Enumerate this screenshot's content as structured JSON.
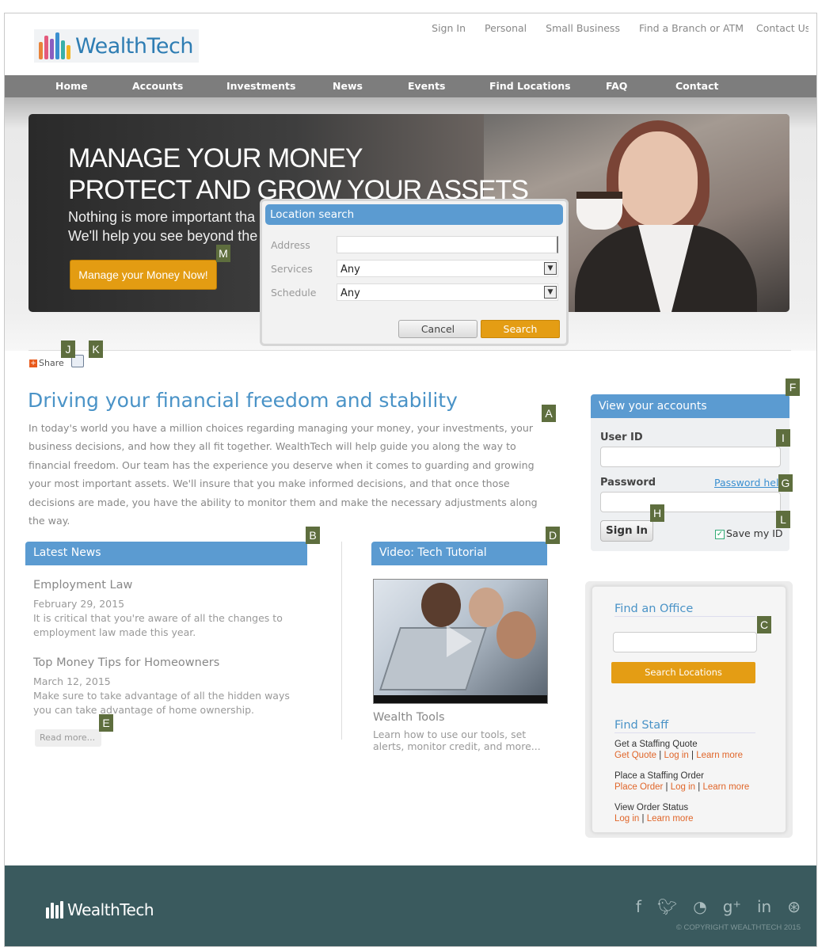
{
  "header": {
    "logo_text": "WealthTech",
    "top_links": [
      "Sign In",
      "Personal",
      "Small Business",
      "Find a Branch or ATM",
      "Contact Us"
    ]
  },
  "nav": {
    "items": [
      "Home",
      "Accounts",
      "Investments",
      "News",
      "Events",
      "Find Locations",
      "FAQ",
      "Contact"
    ]
  },
  "hero": {
    "headline_1": "MANAGE YOUR MONEY",
    "headline_2": "PROTECT AND GROW YOUR ASSETS",
    "sub_1": "Nothing is more important tha",
    "sub_2": "We'll help you see beyond the r",
    "button": "Manage your Money Now!"
  },
  "dialog": {
    "title": "Location search",
    "address_label": "Address",
    "address_value": "",
    "services_label": "Services",
    "services_value": "Any",
    "schedule_label": "Schedule",
    "schedule_value": "Any",
    "cancel": "Cancel",
    "search": "Search"
  },
  "share": {
    "label": "Share"
  },
  "main": {
    "title": "Driving your financial freedom and stability",
    "paragraph": "In today's world you have a million choices regarding managing your money, your investments, your business decisions, and how they all fit together.  WealthTech will help guide you along the way to financial freedom.  Our team has the experience you deserve when it comes to guarding and growing your most important assets. We'll insure that you make informed decisions, and that once those decisions are made, you have the ability to monitor them and make the necessary adjustments along the way."
  },
  "news": {
    "header": "Latest News",
    "items": [
      {
        "title": "Employment Law",
        "date": "February 29, 2015",
        "text": "It is critical that you're aware of all the changes to employment law made this year."
      },
      {
        "title": "Top Money Tips for Homeowners",
        "date": "March 12, 2015",
        "text": "Make sure to take advantage of all the hidden ways you can take advantage of home ownership."
      }
    ],
    "read_more": "Read more..."
  },
  "video": {
    "header": "Video: Tech Tutorial",
    "title": "Wealth Tools",
    "text": "Learn how to use our tools, set alerts, monitor credit, and more..."
  },
  "accounts": {
    "header": "View your accounts",
    "user_id_label": "User ID",
    "password_label": "Password",
    "password_help": "Password help",
    "sign_in": "Sign In",
    "save_id": "Save my ID",
    "save_id_checked": true
  },
  "office": {
    "find_office": "Find an Office",
    "search_button": "Search Locations",
    "find_staff": "Find Staff",
    "staff_groups": [
      {
        "title": "Get a Staffing Quote",
        "links": [
          "Get Quote",
          "Log in",
          "Learn more"
        ]
      },
      {
        "title": "Place a Staffing Order",
        "links": [
          "Place Order",
          "Log in",
          "Learn more"
        ]
      },
      {
        "title": "View Order Status",
        "links": [
          "Log in",
          "Learn more"
        ]
      }
    ]
  },
  "markers": [
    "A",
    "B",
    "C",
    "D",
    "E",
    "F",
    "G",
    "H",
    "I",
    "J",
    "K",
    "L",
    "M"
  ],
  "footer": {
    "logo_text": "WealthTech",
    "social_icons": [
      "facebook-icon",
      "twitter-icon",
      "rss-icon",
      "google-plus-icon",
      "linkedin-icon",
      "dribbble-icon"
    ],
    "copyright": "© COPYRIGHT WEALTHTECH 2015"
  },
  "colors": {
    "accent_blue": "#5b9bd1",
    "heading_blue": "#4a93c7",
    "orange": "#e49d14",
    "nav_gray": "#7d7d7d",
    "footer_teal": "#3a5a5e",
    "marker_olive": "#5e6e3e"
  }
}
